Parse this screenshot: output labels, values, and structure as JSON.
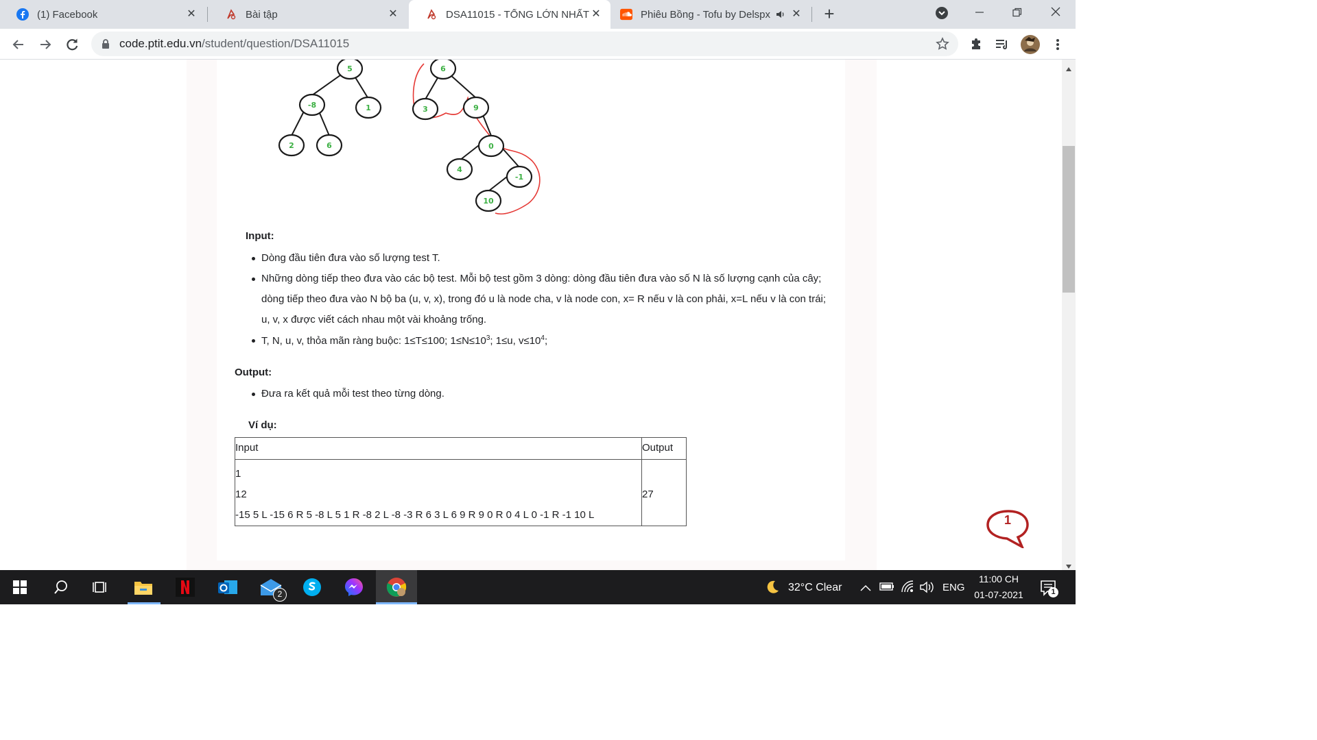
{
  "browser": {
    "tabs": [
      {
        "title": "(1) Facebook",
        "icon": "facebook-icon",
        "active": false
      },
      {
        "title": "Bài tập",
        "icon": "ptit-icon",
        "active": false
      },
      {
        "title": "DSA11015 - TỔNG LỚN NHẤT",
        "icon": "ptit-icon",
        "active": true
      },
      {
        "title": "Phiêu Bồng - Tofu by Delspx",
        "icon": "soundcloud-icon",
        "active": false,
        "audio": "speaker-icon"
      }
    ],
    "tab_close_symbol": "✕",
    "new_tab_symbol": "+",
    "url_host": "code.ptit.edu.vn",
    "url_path": "/student/question/DSA11015",
    "colors": {
      "tab_strip": "#dee1e6",
      "facebook": "#1877f2",
      "soundcloud": "#ff5500",
      "ptit_red": "#c0392b"
    }
  },
  "problem": {
    "figure": {
      "node_color": "#3cb043",
      "curve_color": "#e53935",
      "tree1_nodes": [
        "5",
        "-8",
        "1",
        "2",
        "6"
      ],
      "tree2_nodes": [
        "6",
        "3",
        "9",
        "0",
        "4",
        "-1",
        "10"
      ]
    },
    "input_heading": "Input:",
    "input_items": [
      "Dòng đầu tiên đưa vào số lượng test T.",
      "Những dòng tiếp theo đưa vào các bộ test. Mỗi bộ test gồm 3 dòng: dòng đầu tiên đưa vào số N là số lượng cạnh của cây;",
      "dòng tiếp theo đưa vào N bộ ba (u, v, x), trong đó u là node cha, v là node con, x= R nếu v là con phải, x=L nếu v là con trái;",
      "u, v, x được viết cách nhau một vài khoảng trống."
    ],
    "constraint": {
      "prefix": "T, N, u, v, thỏa mãn ràng buộc: 1≤T≤100; 1≤N≤10",
      "exp1": "3",
      "middle": "; 1≤u, v≤10",
      "exp2": "4",
      "suffix": ";"
    },
    "output_heading": "Output:",
    "output_items": [
      "Đưa ra kết quả mỗi test theo từng dòng."
    ],
    "example_heading": "Ví dụ:",
    "example": {
      "headers": [
        "Input",
        "Output"
      ],
      "input_lines": [
        "1",
        "12",
        "-15 5 L -15 6 R 5 -8 L 5 1 R -8 2 L -8 -3 R 6 3 L 6 9 R 9 0 R 0 4 L 0 -1 R -1 10 L"
      ],
      "output_value": "27"
    }
  },
  "chat_badge": {
    "count": "1",
    "color": "#b22222"
  },
  "taskbar": {
    "apps": [
      "windows-start-icon",
      "search-icon",
      "task-view-icon",
      "file-explorer-icon",
      "netflix-icon",
      "outlook-icon",
      "mail-icon",
      "skype-icon",
      "messenger-icon",
      "chrome-icon"
    ],
    "mail_badge": "2",
    "weather": "32°C  Clear",
    "language": "ENG",
    "time": "11:00 CH",
    "date": "01-07-2021",
    "notification_count": "1"
  }
}
